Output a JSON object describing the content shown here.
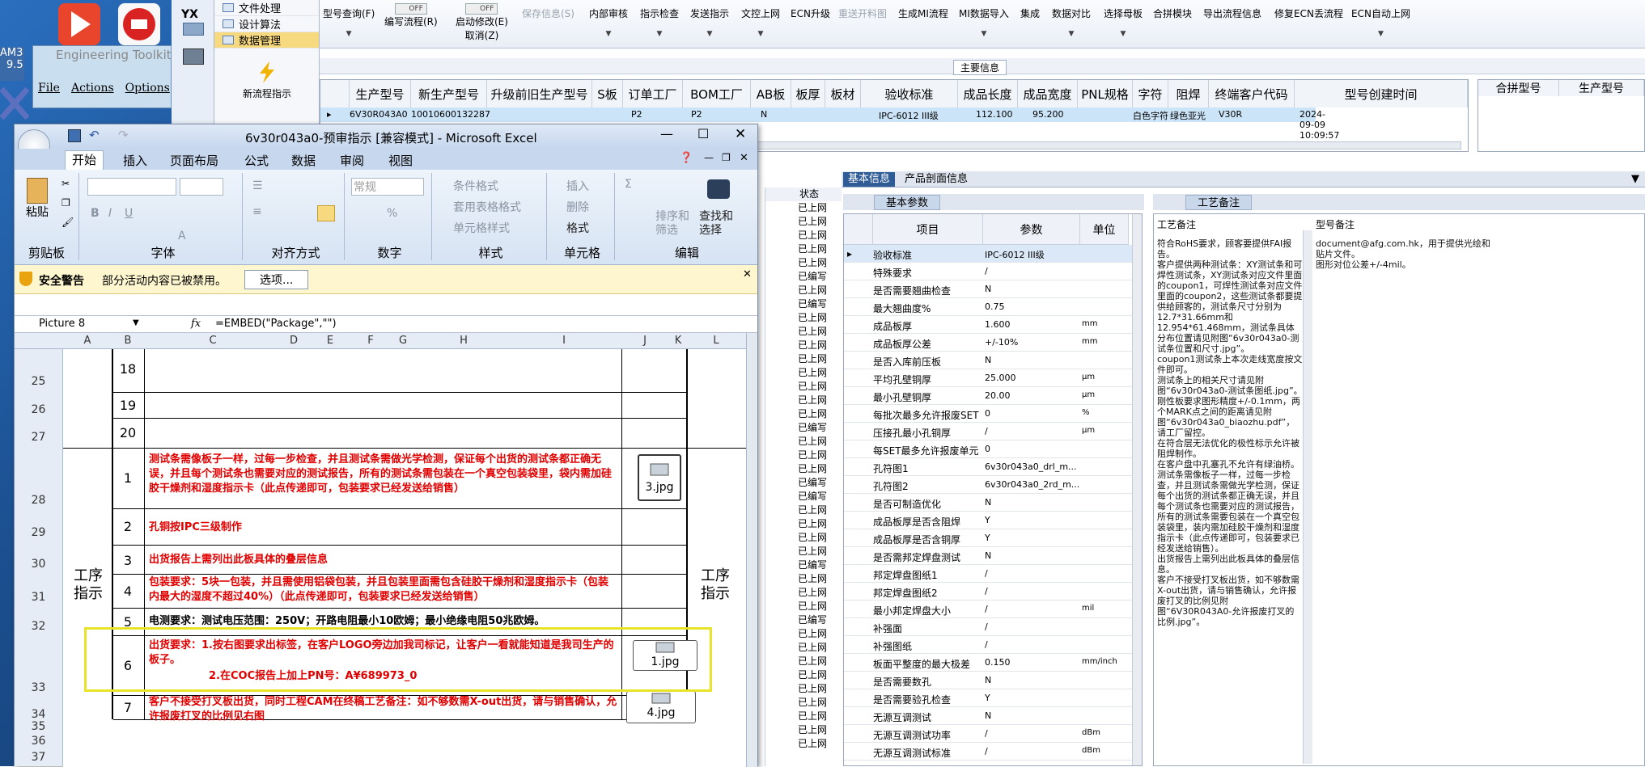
{
  "desktop": {
    "tile_partial_1": "AM3",
    "tile_partial_2": "9.5",
    "engineering_toolkit_title": "Engineering Toolkit",
    "menu": [
      "File",
      "Actions",
      "Options"
    ]
  },
  "left_nav": {
    "yx_label": "YX",
    "items": [
      "文件处理",
      "设计算法",
      "数据管理"
    ],
    "selected_index": 2,
    "new_process_label": "新流程指示"
  },
  "toolbar": {
    "items": [
      {
        "label": "型号查询(F)",
        "enabled": true
      },
      {
        "label": "编写流程(R)",
        "enabled": true,
        "toggle": "OFF"
      },
      {
        "label": "启动修改(E)",
        "sub": "取消(Z)",
        "enabled": true,
        "toggle": "OFF"
      },
      {
        "label": "保存信息(S)",
        "enabled": false
      },
      {
        "label": "内部审核",
        "enabled": true
      },
      {
        "label": "指示检查",
        "enabled": true
      },
      {
        "label": "发送指示",
        "enabled": true
      },
      {
        "label": "文控上网",
        "enabled": true
      },
      {
        "label": "ECN升级",
        "enabled": true
      },
      {
        "label": "重送开料图",
        "enabled": false
      },
      {
        "label": "生成MI流程",
        "enabled": true
      },
      {
        "label": "MI数据导入",
        "enabled": true
      },
      {
        "label": "集成",
        "enabled": true
      },
      {
        "label": "数据对比",
        "enabled": true
      },
      {
        "label": "选择母板",
        "enabled": true
      },
      {
        "label": "合拼模块",
        "enabled": true
      },
      {
        "label": "导出流程信息",
        "enabled": true
      },
      {
        "label": "修复ECN丢流程",
        "enabled": true
      },
      {
        "label": "ECN自动上网",
        "enabled": true
      }
    ]
  },
  "main_info": {
    "section_title": "主要信息",
    "columns": [
      "生产型号",
      "新生产型号",
      "升级前旧生产型号",
      "S板",
      "订单工厂",
      "BOM工厂",
      "AB板",
      "板厚",
      "板材",
      "验收标准",
      "成品长度",
      "成品宽度",
      "PNL规格",
      "字符",
      "阻焊",
      "终端客户代码",
      "型号创建时间"
    ],
    "row": [
      "6V30R043A0",
      "10010600132287",
      "",
      "",
      "P2",
      "P2",
      "N",
      "",
      "",
      "IPC-6012 III级",
      "112.100",
      "95.200",
      "",
      "白色字符",
      "绿色亚光",
      "V30R",
      "2024-09-09 10:09:57"
    ],
    "side_columns": [
      "合拼型号",
      "生产型号"
    ]
  },
  "detail_tabs": [
    "基本信息",
    "产品剖面信息"
  ],
  "basic_params": {
    "tab": "基本参数",
    "headers": [
      "项目",
      "参数",
      "单位"
    ],
    "rows": [
      [
        "验收标准",
        "IPC-6012 III级",
        ""
      ],
      [
        "特殊要求",
        "/",
        ""
      ],
      [
        "是否需要翘曲检查",
        "N",
        ""
      ],
      [
        "最大翘曲度%",
        "0.75",
        ""
      ],
      [
        "成品板厚",
        "1.600",
        "mm"
      ],
      [
        "成品板厚公差",
        "+/-10%",
        "mm"
      ],
      [
        "是否入库前压板",
        "N",
        ""
      ],
      [
        "平均孔壁铜厚",
        "25.000",
        "μm"
      ],
      [
        "最小孔壁铜厚",
        "20.00",
        "μm"
      ],
      [
        "每批次最多允许报废SET",
        "0",
        "%"
      ],
      [
        "压接孔最小孔铜厚",
        "/",
        "μm"
      ],
      [
        "每SET最多允许报废单元",
        "0",
        ""
      ],
      [
        "孔符图1",
        "6v30r043a0_drl_m...",
        ""
      ],
      [
        "孔符图2",
        "6v30r043a0_2rd_m...",
        ""
      ],
      [
        "是否可制造优化",
        "N",
        ""
      ],
      [
        "成品板厚是否含阻焊",
        "Y",
        ""
      ],
      [
        "成品板厚是否含铜厚",
        "Y",
        ""
      ],
      [
        "是否需邦定焊盘测试",
        "N",
        ""
      ],
      [
        "邦定焊盘图纸1",
        "/",
        ""
      ],
      [
        "邦定焊盘图纸2",
        "/",
        ""
      ],
      [
        "最小邦定焊盘大小",
        "/",
        "mil"
      ],
      [
        "补强面",
        "/",
        ""
      ],
      [
        "补强图纸",
        "/",
        ""
      ],
      [
        "板面平整度的最大极差",
        "0.150",
        "mm/inch"
      ],
      [
        "是否需要数孔",
        "N",
        ""
      ],
      [
        "是否需要验孔检查",
        "Y",
        ""
      ],
      [
        "无源互调测试",
        "N",
        ""
      ],
      [
        "无源互调测试功率",
        "/",
        "dBm"
      ],
      [
        "无源互调测试标准",
        "/",
        "dBm"
      ]
    ]
  },
  "process_notes": {
    "tab": "工艺备注",
    "header_left": "工艺备注",
    "header_right": "型号备注",
    "left_text": "符合RoHS要求，顾客要提供FAI报告。\n客户提供两种测试条：XY测试条和可焊性测试条，XY测试条对应文件里面的coupon1，可焊性测试条对应文件里面的coupon2，这些测试条都要提供给顾客的，测试条尺寸分别为12.7*31.66mm和12.954*61.468mm，测试条具体分布位置请见附图“6v30r043a0-测试条位置和尺寸.jpg”。\ncoupon1测试条上本次走线宽度按文件即可。\n测试条上的相关尺寸请见附图“6v30r043a0-测试条图纸.jpg”。\n刚性板要求图形精度+/-0.1mm，两个MARK点之间的距离请见附图“6v30r043a0_biaozhu.pdf”，请工厂留控。\n在符合层无法优化的极性标示允许被阻焊制作。\n在客户盘中孔塞孔不允许有绿油桥。\n测试条需像板子一样，过每一步检查，并且测试条需做光学检测，保证每个出货的测试条都正确无误，并且每个测试条也需要对应的测试报告，所有的测试条需要包装在一个真空包装袋里，装内需加硅胶干燥剂和湿度指示卡（此点传递即可，包装要求已经发送给销售）。\n出货报告上需列出此板具体的叠层信息。\n客户不接受打叉板出货，如不够数需X-out出货，请与销售确认，允许报废打叉的比例见附图“6V30R043A0-允许报废打叉的比例.jpg”。",
    "right_text": "document@afg.com.hk，用于提供光绘和贴片文件。\n图形对位公差+/-4mil。"
  },
  "status_list": {
    "header": "状态",
    "items": [
      "已上网",
      "已上网",
      "已上网",
      "已上网",
      "已上网",
      "已编写",
      "已上网",
      "已编写",
      "已上网",
      "已上网",
      "已上网",
      "已上网",
      "已上网",
      "已上网",
      "已上网",
      "已上网",
      "已编写",
      "已上网",
      "已上网",
      "已上网",
      "已编写",
      "已编写",
      "已上网",
      "已上网",
      "已上网",
      "已上网",
      "已编写",
      "已上网",
      "已上网",
      "已上网",
      "已编写",
      "已上网",
      "已上网",
      "已上网",
      "已上网",
      "已上网",
      "已上网",
      "已上网",
      "已上网",
      "已上网"
    ]
  },
  "excel": {
    "title": "6v30r043a0-预审指示 [兼容模式] - Microsoft Excel",
    "tabs": [
      "开始",
      "插入",
      "页面布局",
      "公式",
      "数据",
      "审阅",
      "视图"
    ],
    "active_tab": 0,
    "groups": {
      "clipboard": "剪贴板",
      "font": "字体",
      "align": "对齐方式",
      "number": "数字",
      "style": "样式",
      "cells": "单元格",
      "edit": "编辑"
    },
    "ribbon_items": {
      "paste": "粘贴",
      "number_format": "常规",
      "cond_format": "条件格式",
      "table_format": "套用表格格式",
      "cell_style": "单元格样式",
      "insert": "插入",
      "delete": "删除",
      "format": "格式",
      "sort": "排序和\n筛选",
      "find": "查找和\n选择"
    },
    "security_label": "安全警告",
    "security_text": "部分活动内容已被禁用。",
    "options_button": "选项...",
    "name_box": "Picture 8",
    "fx": "fx",
    "formula": "=EMBED(\"Package\",\"\")",
    "columns": [
      "A",
      "B",
      "C",
      "D",
      "E",
      "F",
      "G",
      "H",
      "I",
      "J",
      "K",
      "L"
    ],
    "rows": [
      "25",
      "26",
      "27",
      "28",
      "29",
      "30",
      "31",
      "32",
      "33",
      "34",
      "35",
      "36",
      "37"
    ],
    "side_label_left": "工序\n指示",
    "side_label_right": "工序\n指示",
    "numbers_top": [
      "18",
      "19",
      "20"
    ],
    "items": [
      {
        "no": "1",
        "text": "测试条需像板子一样，过每一步检查，并且测试条需做光学检测，保证每个出货的测试条都正确无误，并且每个测试条也需要对应的测试报告，所有的测试条需包装在一个真空包装袋里，袋内需加硅胶干燥剂和湿度指示卡（此点传递即可，包装要求已经发送给销售）",
        "color": "#e00000"
      },
      {
        "no": "2",
        "text": "孔铜按IPC三级制作",
        "color": "#e00000"
      },
      {
        "no": "3",
        "text": "出货报告上需列出此板具体的叠层信息",
        "color": "#e00000"
      },
      {
        "no": "4",
        "text": "包装要求：5块一包装，并且需使用铝袋包装，并且包装里面需包含硅胶干燥剂和湿度指示卡（包装内最大的湿度不超过40%）（此点传递即可，包装要求已经发送给销售）",
        "color": "#e00000"
      },
      {
        "no": "5",
        "text": "电测要求：测试电压范围：250V；开路电阻最小10欧姆；最小绝缘电阻50兆欧姆。",
        "color": "#000000"
      },
      {
        "no": "6",
        "text": "出货要求：1.按右图要求出标签，在客户LOGO旁边加我司标记，让客户一看就能知道是我司生产的板子。",
        "text2": "2.在COC报告上加上PN号：A¥689973_0",
        "color": "#e00000"
      },
      {
        "no": "7",
        "text": "客户不接受打叉板出货，同时工程CAM在终稿工艺备注：如不够数需X-out出货，请与销售确认，允许报废打叉的比例见右图",
        "color": "#e00000"
      }
    ],
    "attachments": [
      "3.jpg",
      "1.jpg",
      "4.jpg"
    ]
  },
  "colors": {
    "accent": "#2f5b96",
    "selected_row": "#cce4f7",
    "nav_selected": "#f7d980",
    "highlight_box": "#e8e42a",
    "red_text": "#e00000"
  }
}
